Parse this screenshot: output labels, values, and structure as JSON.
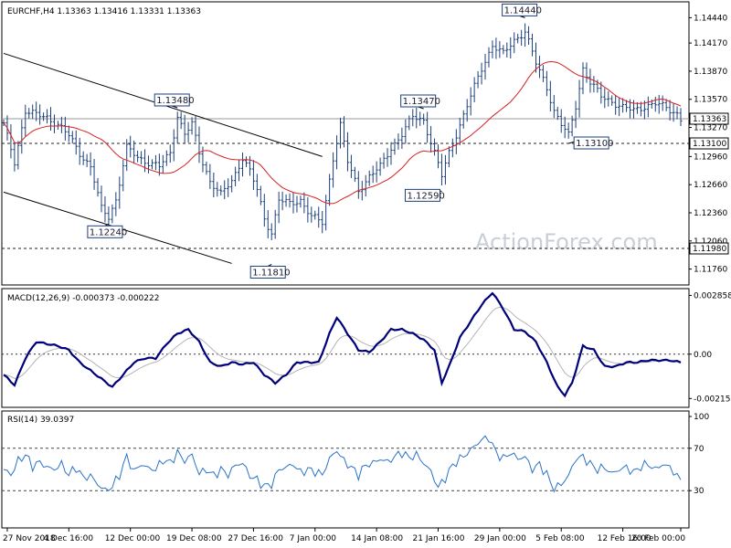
{
  "chart_data": {
    "type": "line",
    "title": "EURCHF,H4  1.13363 1.13416 1.13331 1.13363",
    "watermark": "ActionForex.com",
    "price": {
      "yrange": [
        1.1161,
        1.1459
      ],
      "ticks": [
        "1.14440",
        "1.14170",
        "1.13870",
        "1.13570",
        "1.13270",
        "1.12960",
        "1.12660",
        "1.12360",
        "1.12060",
        "1.11760"
      ],
      "tick_values": [
        1.1444,
        1.1417,
        1.1387,
        1.1357,
        1.1327,
        1.1296,
        1.1266,
        1.1236,
        1.1206,
        1.1176
      ],
      "current_label": "1.13363",
      "current_value": 1.13363,
      "level_labels": [
        {
          "text": "1.13100",
          "value": 1.131
        },
        {
          "text": "1.11980",
          "value": 1.1198
        }
      ],
      "annotations": [
        {
          "text": "1.13480",
          "bar": 48,
          "value": 1.1348
        },
        {
          "text": "1.12240",
          "bar": 29,
          "value": 1.1224
        },
        {
          "text": "1.11810",
          "bar": 74,
          "value": 1.1181
        },
        {
          "text": "1.13470",
          "bar": 116,
          "value": 1.1347
        },
        {
          "text": "1.12590",
          "bar": 121,
          "value": 1.1259
        },
        {
          "text": "1.14440",
          "bar": 144,
          "value": 1.1444
        },
        {
          "text": "1.13100",
          "bar": 156,
          "value": 1.131
        }
      ],
      "anchors": [
        [
          0,
          1.133
        ],
        [
          3,
          1.129
        ],
        [
          6,
          1.1345
        ],
        [
          9,
          1.134
        ],
        [
          12,
          1.1338
        ],
        [
          15,
          1.133
        ],
        [
          18,
          1.1318
        ],
        [
          21,
          1.13
        ],
        [
          24,
          1.1285
        ],
        [
          27,
          1.124
        ],
        [
          29,
          1.1232
        ],
        [
          31,
          1.125
        ],
        [
          34,
          1.1305
        ],
        [
          37,
          1.1295
        ],
        [
          40,
          1.129
        ],
        [
          43,
          1.1285
        ],
        [
          46,
          1.13
        ],
        [
          48,
          1.134
        ],
        [
          50,
          1.132
        ],
        [
          52,
          1.133
        ],
        [
          54,
          1.13
        ],
        [
          57,
          1.127
        ],
        [
          60,
          1.1255
        ],
        [
          63,
          1.127
        ],
        [
          66,
          1.1295
        ],
        [
          68,
          1.128
        ],
        [
          70,
          1.126
        ],
        [
          72,
          1.123
        ],
        [
          74,
          1.1215
        ],
        [
          76,
          1.125
        ],
        [
          79,
          1.1245
        ],
        [
          82,
          1.125
        ],
        [
          85,
          1.1232
        ],
        [
          88,
          1.1225
        ],
        [
          91,
          1.1295
        ],
        [
          93,
          1.133
        ],
        [
          95,
          1.129
        ],
        [
          98,
          1.126
        ],
        [
          101,
          1.1275
        ],
        [
          104,
          1.1285
        ],
        [
          107,
          1.1305
        ],
        [
          110,
          1.132
        ],
        [
          113,
          1.1338
        ],
        [
          116,
          1.1335
        ],
        [
          119,
          1.13
        ],
        [
          121,
          1.1275
        ],
        [
          123,
          1.13
        ],
        [
          126,
          1.133
        ],
        [
          129,
          1.136
        ],
        [
          132,
          1.139
        ],
        [
          135,
          1.1415
        ],
        [
          138,
          1.1405
        ],
        [
          141,
          1.142
        ],
        [
          144,
          1.143
        ],
        [
          147,
          1.1395
        ],
        [
          150,
          1.137
        ],
        [
          152,
          1.1345
        ],
        [
          154,
          1.133
        ],
        [
          156,
          1.1318
        ],
        [
          158,
          1.135
        ],
        [
          160,
          1.139
        ],
        [
          162,
          1.1375
        ],
        [
          165,
          1.136
        ],
        [
          168,
          1.1355
        ],
        [
          171,
          1.1348
        ],
        [
          174,
          1.1345
        ],
        [
          177,
          1.135
        ],
        [
          180,
          1.1352
        ],
        [
          183,
          1.1348
        ],
        [
          186,
          1.1342
        ],
        [
          187,
          1.1336
        ]
      ],
      "line_color": "#1c3f78",
      "ma_color": "#d62020",
      "channel_upper": [
        [
          0,
          1.1406
        ],
        [
          88,
          1.1296
        ]
      ],
      "channel_lower": [
        [
          0,
          1.1258
        ],
        [
          63,
          1.1182
        ]
      ]
    },
    "bars_count": 188,
    "macd": {
      "title": "MACD(12,26,9) -0.000373 -0.000222",
      "yrange": [
        -0.0025,
        0.0031
      ],
      "ticks": [
        "0.002858",
        "0.00",
        "-0.002158"
      ],
      "tick_values": [
        0.002858,
        0.0,
        -0.002158
      ],
      "zero_label": "0.00",
      "anchors": [
        [
          0,
          -0.001
        ],
        [
          3,
          -0.0015
        ],
        [
          6,
          -0.0002
        ],
        [
          9,
          0.0006
        ],
        [
          12,
          0.0005
        ],
        [
          15,
          0.0004
        ],
        [
          18,
          0.0002
        ],
        [
          21,
          -0.0004
        ],
        [
          24,
          -0.0008
        ],
        [
          27,
          -0.0012
        ],
        [
          30,
          -0.0016
        ],
        [
          33,
          -0.001
        ],
        [
          36,
          -0.0004
        ],
        [
          39,
          -0.0002
        ],
        [
          42,
          -0.0002
        ],
        [
          45,
          0.0005
        ],
        [
          48,
          0.001
        ],
        [
          51,
          0.0012
        ],
        [
          54,
          0.0006
        ],
        [
          57,
          -0.0004
        ],
        [
          60,
          -0.0006
        ],
        [
          63,
          -0.0004
        ],
        [
          66,
          -0.0005
        ],
        [
          69,
          -0.0004
        ],
        [
          72,
          -0.001
        ],
        [
          75,
          -0.0014
        ],
        [
          78,
          -0.001
        ],
        [
          81,
          -0.0004
        ],
        [
          84,
          -0.0004
        ],
        [
          87,
          -0.0004
        ],
        [
          90,
          0.001
        ],
        [
          92,
          0.0018
        ],
        [
          95,
          0.001
        ],
        [
          98,
          0.0002
        ],
        [
          101,
          0.0001
        ],
        [
          104,
          0.0006
        ],
        [
          107,
          0.0012
        ],
        [
          110,
          0.0012
        ],
        [
          113,
          0.001
        ],
        [
          116,
          0.0007
        ],
        [
          119,
          0.0002
        ],
        [
          121,
          -0.0014
        ],
        [
          123,
          -0.0006
        ],
        [
          126,
          0.0008
        ],
        [
          129,
          0.0016
        ],
        [
          132,
          0.0024
        ],
        [
          135,
          0.003
        ],
        [
          138,
          0.0022
        ],
        [
          141,
          0.0012
        ],
        [
          144,
          0.0011
        ],
        [
          147,
          0.0006
        ],
        [
          150,
          -0.0004
        ],
        [
          153,
          -0.0016
        ],
        [
          155,
          -0.002
        ],
        [
          157,
          -0.0014
        ],
        [
          160,
          0.0004
        ],
        [
          163,
          0.0002
        ],
        [
          166,
          -0.0006
        ],
        [
          169,
          -0.0006
        ],
        [
          172,
          -0.0004
        ],
        [
          175,
          -0.0004
        ],
        [
          178,
          -0.0003
        ],
        [
          181,
          -0.0003
        ],
        [
          184,
          -0.0003
        ],
        [
          187,
          -0.0004
        ]
      ],
      "line_color": "#00007a",
      "signal_color": "#b5b5b5"
    },
    "rsi": {
      "title": "RSI(14) 39.0397",
      "yrange": [
        0,
        100
      ],
      "ticks": [
        "100",
        "70",
        "30"
      ],
      "tick_values": [
        100,
        70,
        30
      ],
      "anchors": [
        [
          0,
          50
        ],
        [
          2,
          45
        ],
        [
          4,
          58
        ],
        [
          6,
          64
        ],
        [
          8,
          53
        ],
        [
          10,
          57
        ],
        [
          12,
          52
        ],
        [
          14,
          50
        ],
        [
          16,
          55
        ],
        [
          18,
          45
        ],
        [
          20,
          52
        ],
        [
          22,
          42
        ],
        [
          24,
          44
        ],
        [
          26,
          36
        ],
        [
          28,
          30
        ],
        [
          30,
          34
        ],
        [
          32,
          45
        ],
        [
          34,
          62
        ],
        [
          36,
          48
        ],
        [
          38,
          55
        ],
        [
          40,
          51
        ],
        [
          42,
          50
        ],
        [
          44,
          59
        ],
        [
          46,
          56
        ],
        [
          48,
          66
        ],
        [
          50,
          58
        ],
        [
          52,
          64
        ],
        [
          54,
          46
        ],
        [
          56,
          50
        ],
        [
          58,
          44
        ],
        [
          60,
          50
        ],
        [
          62,
          45
        ],
        [
          64,
          54
        ],
        [
          66,
          56
        ],
        [
          68,
          44
        ],
        [
          70,
          40
        ],
        [
          72,
          34
        ],
        [
          74,
          36
        ],
        [
          76,
          50
        ],
        [
          78,
          52
        ],
        [
          80,
          55
        ],
        [
          82,
          47
        ],
        [
          84,
          50
        ],
        [
          86,
          48
        ],
        [
          88,
          45
        ],
        [
          90,
          60
        ],
        [
          92,
          68
        ],
        [
          94,
          58
        ],
        [
          96,
          52
        ],
        [
          98,
          45
        ],
        [
          100,
          54
        ],
        [
          102,
          56
        ],
        [
          104,
          60
        ],
        [
          106,
          57
        ],
        [
          108,
          62
        ],
        [
          110,
          66
        ],
        [
          112,
          61
        ],
        [
          114,
          64
        ],
        [
          116,
          56
        ],
        [
          118,
          48
        ],
        [
          120,
          33
        ],
        [
          122,
          42
        ],
        [
          124,
          54
        ],
        [
          126,
          60
        ],
        [
          128,
          65
        ],
        [
          130,
          72
        ],
        [
          132,
          78
        ],
        [
          134,
          80
        ],
        [
          136,
          66
        ],
        [
          138,
          60
        ],
        [
          140,
          66
        ],
        [
          142,
          60
        ],
        [
          144,
          62
        ],
        [
          146,
          50
        ],
        [
          148,
          55
        ],
        [
          150,
          45
        ],
        [
          152,
          32
        ],
        [
          154,
          36
        ],
        [
          156,
          44
        ],
        [
          158,
          60
        ],
        [
          160,
          62
        ],
        [
          162,
          55
        ],
        [
          164,
          50
        ],
        [
          166,
          52
        ],
        [
          168,
          46
        ],
        [
          170,
          50
        ],
        [
          172,
          52
        ],
        [
          174,
          47
        ],
        [
          176,
          53
        ],
        [
          178,
          55
        ],
        [
          180,
          50
        ],
        [
          182,
          55
        ],
        [
          184,
          52
        ],
        [
          186,
          44
        ],
        [
          187,
          39
        ]
      ],
      "line_color": "#2a73c8"
    },
    "x_labels": [
      {
        "text": "27 Nov 2018",
        "bar": 1
      },
      {
        "text": "4 Dec 16:00",
        "bar": 18
      },
      {
        "text": "12 Dec 00:00",
        "bar": 35
      },
      {
        "text": "19 Dec 08:00",
        "bar": 52
      },
      {
        "text": "27 Dec 16:00",
        "bar": 69
      },
      {
        "text": "7 Jan 00:00",
        "bar": 86
      },
      {
        "text": "14 Jan 08:00",
        "bar": 103
      },
      {
        "text": "21 Jan 16:00",
        "bar": 120
      },
      {
        "text": "29 Jan 00:00",
        "bar": 137
      },
      {
        "text": "5 Feb 08:00",
        "bar": 154
      },
      {
        "text": "12 Feb 16:00",
        "bar": 171
      },
      {
        "text": "20 Feb 00:00",
        "bar": 188
      }
    ],
    "grid": false
  }
}
